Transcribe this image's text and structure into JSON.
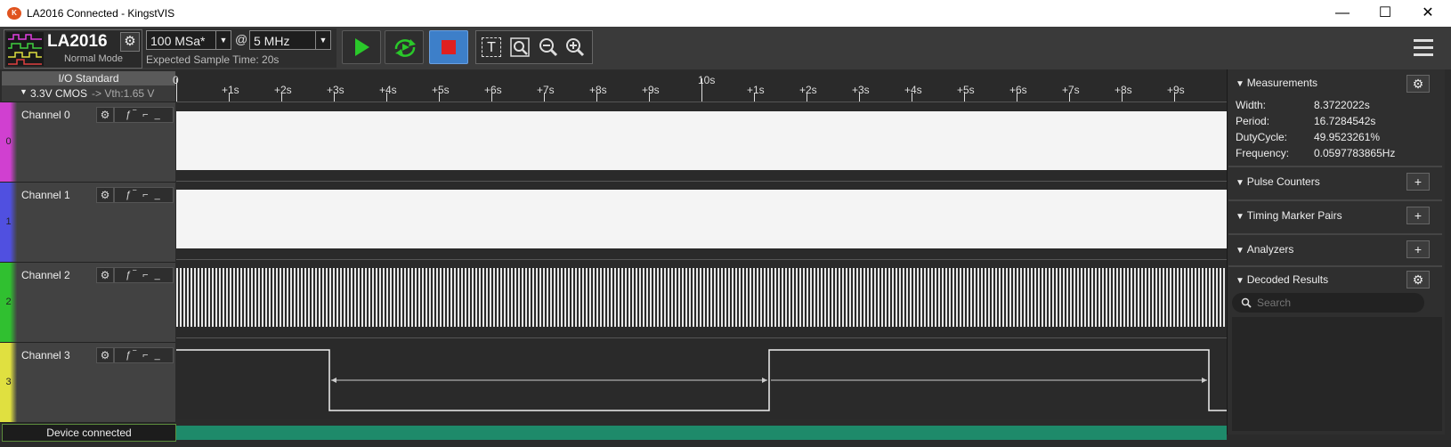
{
  "window": {
    "logo_text": "K",
    "title": "LA2016 Connected - KingstVIS",
    "minimize": "—",
    "maximize": "☐",
    "close": "✕"
  },
  "toolbar": {
    "device_name": "LA2016",
    "mode": "Normal Mode",
    "sample_rate": "100 MSa*",
    "at": "@",
    "sample_depth": "5 MHz",
    "expected_time": "Expected Sample Time: 20s",
    "menu_icon": "hamburger-icon"
  },
  "io_standard": {
    "label": "I/O Standard",
    "value": "3.3V CMOS",
    "vth": "-> Vth:1.65 V"
  },
  "ruler": {
    "ticks": [
      "0",
      "+1s",
      "+2s",
      "+3s",
      "+4s",
      "+5s",
      "+6s",
      "+7s",
      "+8s",
      "+9s",
      "10s",
      "+1s",
      "+2s",
      "+3s",
      "+4s",
      "+5s",
      "+6s",
      "+7s",
      "+8s",
      "+9s"
    ]
  },
  "channels": [
    {
      "name": "Channel 0",
      "num": "0",
      "color": "#d040d0"
    },
    {
      "name": "Channel 1",
      "num": "1",
      "color": "#5050e0"
    },
    {
      "name": "Channel 2",
      "num": "2",
      "color": "#30c030"
    },
    {
      "name": "Channel 3",
      "num": "3",
      "color": "#e0e040"
    }
  ],
  "status": {
    "text": "Device connected"
  },
  "measurements": {
    "header": "Measurements",
    "width_label": "Width:",
    "width_value": "8.3722022s",
    "period_label": "Period:",
    "period_value": "16.7284542s",
    "duty_label": "DutyCycle:",
    "duty_value": "49.9523261%",
    "freq_label": "Frequency:",
    "freq_value": "0.0597783865Hz"
  },
  "sections": {
    "pulse_counters": "Pulse Counters",
    "timing_marker_pairs": "Timing Marker Pairs",
    "analyzers": "Analyzers",
    "decoded_results": "Decoded Results"
  },
  "search": {
    "placeholder": "Search"
  }
}
